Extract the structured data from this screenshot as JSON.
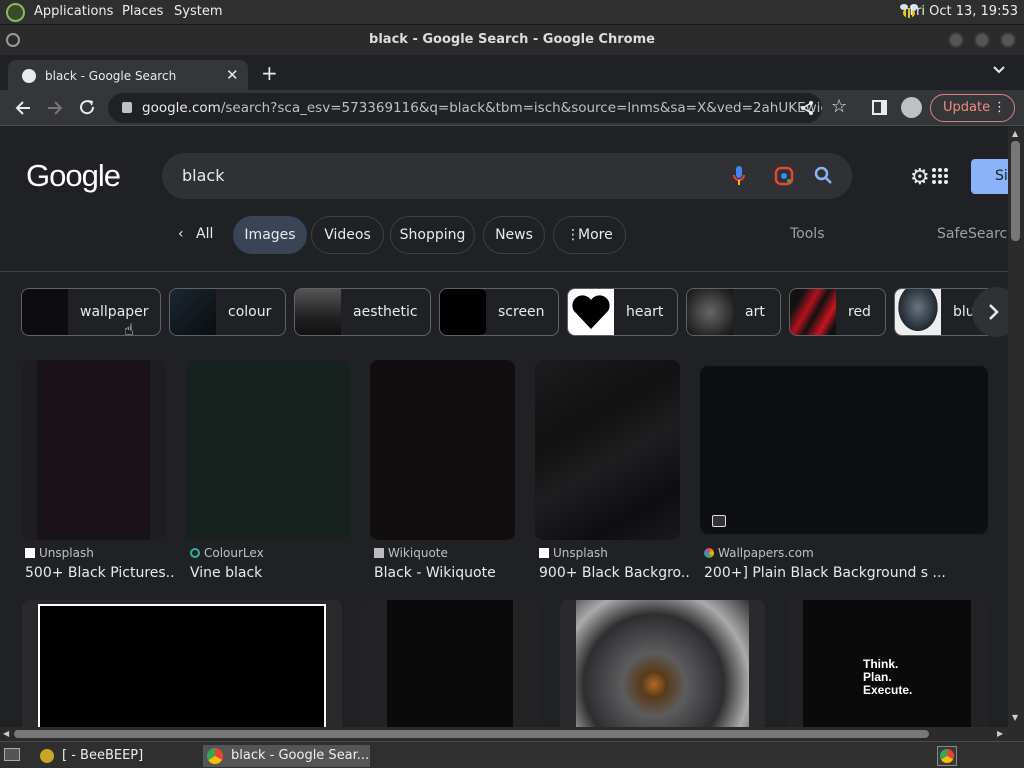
{
  "panel": {
    "menus": [
      "Applications",
      "Places",
      "System"
    ],
    "clock": "Fri Oct 13, 19:53"
  },
  "window": {
    "title": "black - Google Search - Google Chrome"
  },
  "tab": {
    "title": "black - Google Search"
  },
  "omnibox": {
    "host": "google.com",
    "path": "/search?sca_esv=573369116&q=black&tbm=isch&source=lnms&sa=X&ved=2ahUKEwidlaD..."
  },
  "toolbar": {
    "update_label": "Update"
  },
  "google": {
    "logo": "Google",
    "query": "black",
    "signin_partial": "Si",
    "nav": {
      "back_label": "All",
      "items": [
        "Images",
        "Videos",
        "Shopping",
        "News",
        "More"
      ],
      "active": "Images",
      "tools": "Tools",
      "safesearch": "SafeSearch"
    },
    "chips": [
      "wallpaper",
      "colour",
      "aesthetic",
      "screen",
      "heart",
      "art",
      "red",
      "blu"
    ],
    "results_row1": [
      {
        "source": "Unsplash",
        "title": "500+ Black Pictures...",
        "color": "#1a1418"
      },
      {
        "source": "ColourLex",
        "title": "Vine black",
        "color": "#17211e"
      },
      {
        "source": "Wikiquote",
        "title": "Black - Wikiquote",
        "color": "#120e10"
      },
      {
        "source": "Unsplash",
        "title": "900+ Black Backgro...",
        "color": "#151516"
      },
      {
        "source": "Wallpapers.com",
        "title": "200+] Plain Black Background s ...",
        "color": "#0e0f12"
      }
    ],
    "results_row2_overlay": [
      "Think.",
      "Plan.",
      "Execute."
    ]
  },
  "taskbar": {
    "items": [
      "[ - BeeBEEP]",
      "black - Google Sear..."
    ]
  }
}
